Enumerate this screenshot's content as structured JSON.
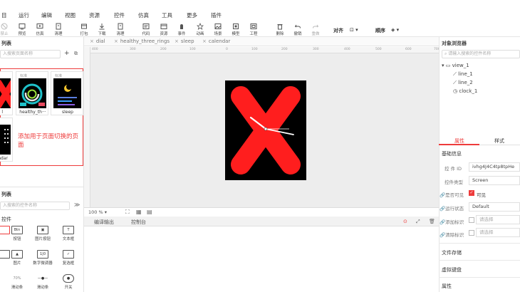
{
  "menu": [
    "目",
    "运行",
    "编辑",
    "视图",
    "资源",
    "控件",
    "仿真",
    "工具",
    "更多",
    "插件"
  ],
  "toolbar": {
    "buttons": [
      {
        "label": "禁止",
        "icon": "ban-icon",
        "disabled": true
      },
      {
        "label": "预览",
        "icon": "preview-icon"
      },
      {
        "label": "仿真",
        "icon": "simulate-icon"
      },
      {
        "label": "清理",
        "icon": "clean-icon"
      },
      {
        "label": "打包",
        "icon": "package-icon"
      },
      {
        "label": "下载",
        "icon": "download-icon"
      },
      {
        "label": "清理",
        "icon": "clean-icon"
      },
      {
        "label": "代码",
        "icon": "code-icon"
      },
      {
        "label": "资源",
        "icon": "resource-icon"
      },
      {
        "label": "事件",
        "icon": "event-icon"
      },
      {
        "label": "动画",
        "icon": "animation-icon"
      },
      {
        "label": "场景",
        "icon": "scene-icon"
      },
      {
        "label": "模型",
        "icon": "model-icon"
      },
      {
        "label": "工程",
        "icon": "project-icon"
      },
      {
        "label": "删除",
        "icon": "delete-icon"
      },
      {
        "label": "撤销",
        "icon": "undo-icon"
      },
      {
        "label": "重做",
        "icon": "redo-icon",
        "disabled": true
      }
    ],
    "align_label": "对齐",
    "order_label": "顺序"
  },
  "pages_panel": {
    "title": "列表",
    "search_placeholder": "入搜索页面名称",
    "pages": [
      {
        "name": "l",
        "tag": "",
        "thumb": "x"
      },
      {
        "name": "healthy_th···",
        "tag": "标准",
        "thumb": "rings"
      },
      {
        "name": "sleep",
        "tag": "标准",
        "thumb": "sleep"
      },
      {
        "name": "endar",
        "tag": "",
        "thumb": "calendar"
      }
    ],
    "annotation": "添加用于页面切换的页面"
  },
  "controls_panel": {
    "title": "列表",
    "search_placeholder": "入搜索的控件名称",
    "section": "控件",
    "items": [
      {
        "label": "",
        "box": ""
      },
      {
        "label": "按钮",
        "box": "Btn"
      },
      {
        "label": "图片按钮",
        "box": ""
      },
      {
        "label": "文本框",
        "box": "T"
      },
      {
        "label": "",
        "box": ""
      },
      {
        "label": "图片",
        "box": ""
      },
      {
        "label": "数字微调器",
        "box": "1|0"
      },
      {
        "label": "复选框",
        "box": "✓"
      },
      {
        "label": "滑动条",
        "box": "70%"
      },
      {
        "label": "滑动条",
        "box": ""
      },
      {
        "label": "开关",
        "box": ""
      }
    ]
  },
  "tabs": [
    "dial",
    "healthy_three_rings",
    "sleep",
    "calendar"
  ],
  "ruler_labels": [
    "400",
    "300",
    "200",
    "100",
    "0",
    "100",
    "200",
    "300",
    "400",
    "500",
    "600",
    "700"
  ],
  "canvas": {
    "zoom": "100 %"
  },
  "output": {
    "tabs": [
      "编译输出",
      "控制台"
    ]
  },
  "object_browser": {
    "title": "对象浏览器",
    "search_placeholder": "请输入搜索的控件名称",
    "tree": [
      "view_1",
      "line_1",
      "line_2",
      "clock_1"
    ]
  },
  "properties": {
    "tabs": [
      "属性",
      "样式"
    ],
    "basic_section": "基础信息",
    "id_label": "控 件 ID",
    "id_value": "ivhg4J4C4tp8tpHe",
    "type_label": "控件类型",
    "type_value": "Screen",
    "visible_label": "是否可见",
    "visible_value": "可见",
    "run_state_label": "运行状态",
    "run_state_value": "Default",
    "add_tag_label": "添加标识",
    "add_tag_placeholder": "请选择",
    "clear_tag_label": "清除标识",
    "clear_tag_placeholder": "请选择",
    "file_storage": "文件存储",
    "virtual_keyboard": "虚拟键盘",
    "attributes": "属性"
  },
  "colors": {
    "accent_red": "#ee3b3b",
    "x_red": "#ff1e1e"
  }
}
